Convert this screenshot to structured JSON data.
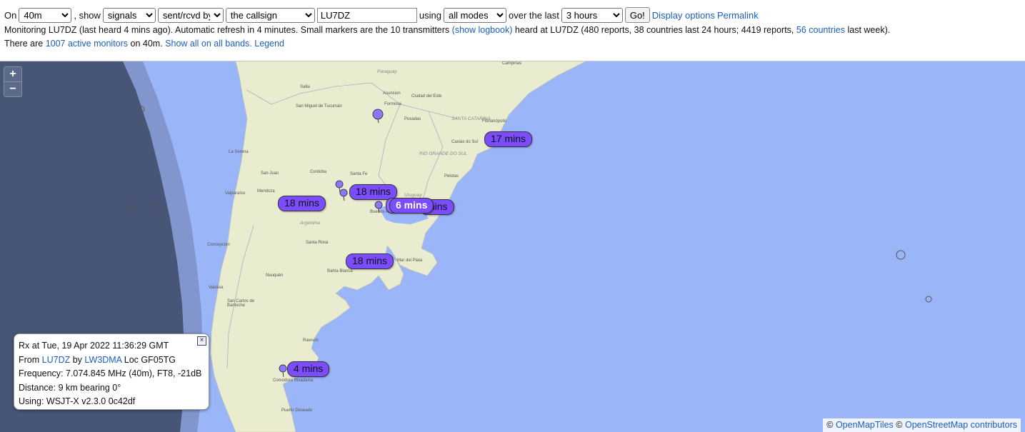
{
  "controls": {
    "on_label": "On",
    "band": "40m",
    "show_label": ", show",
    "show_type": "signals",
    "direction": "sent/rcvd by",
    "target": "the callsign",
    "callsign": "LU7DZ",
    "using_label": "using",
    "modes": "all modes",
    "over_label": "over the last",
    "period": "3 hours",
    "go": "Go!",
    "display_options": "Display options",
    "permalink": "Permalink"
  },
  "status": {
    "line1_a": "Monitoring LU7DZ (last heard 4 mins ago). Automatic refresh in 4 minutes. Small markers are the 10 transmitters",
    "line1_link1": "(show logbook)",
    "line1_b": "heard at LU7DZ (480 reports, 38 countries last 24 hours; 4419 reports,",
    "line1_link2": "56 countries",
    "line1_c": "last week).",
    "line2_a": "There are",
    "line2_link1": "1007 active monitors",
    "line2_b": "on 40m.",
    "line2_link2": "Show all on all bands.",
    "line2_link3": "Legend"
  },
  "map": {
    "zoom_in": "+",
    "zoom_out": "−",
    "cities": [
      "Campinas",
      "Paraguay",
      "Salta",
      "Asuncion",
      "Ciudad del Este",
      "San Miguel de Tucumán",
      "Formosa",
      "Posadas",
      "SANTA CATARINA",
      "Florianópolis",
      "Caxias do Sul",
      "RIO GRANDE DO SUL",
      "La Serena",
      "Cordoba",
      "San Juan",
      "Santa Fe",
      "Pelotas",
      "Valparaíso",
      "Mendoza",
      "Uruguay",
      "Buenos Aires",
      "Argentina",
      "Concepción",
      "Santa Rosa",
      "Neuquén",
      "Bahía Blanca",
      "Mar del Plata",
      "Valdivia",
      "San Carlos de Bariloche",
      "Rawson",
      "Comodoro Rivadavia",
      "Puerto Deseado"
    ],
    "callouts": [
      "17 mins",
      "18 mins",
      "18 mins",
      "6 mins",
      "mins",
      "18 mins",
      "4 mins"
    ]
  },
  "popup": {
    "rx": "Rx at Tue, 19 Apr 2022 11:36:29 GMT",
    "from_label": "From",
    "from_call": "LU7DZ",
    "by_label": "by",
    "by_call": "LW3DMA",
    "loc": "Loc GF05TG",
    "frequency": "Frequency: 7.074.845 MHz (40m), FT8, -21dB",
    "distance": "Distance: 9 km bearing 0°",
    "using": "Using: WSJT-X v2.3.0 0c42df",
    "close": "×"
  },
  "attribution": {
    "c1": "©",
    "l1": "OpenMapTiles",
    "c2": "©",
    "l2": "OpenStreetMap contributors"
  },
  "colors": {
    "ocean": "#9bb5f9",
    "land": "#e9eccf",
    "night": "#2f3a52",
    "marker": "#7b4dff",
    "link": "#1b5fc1"
  }
}
